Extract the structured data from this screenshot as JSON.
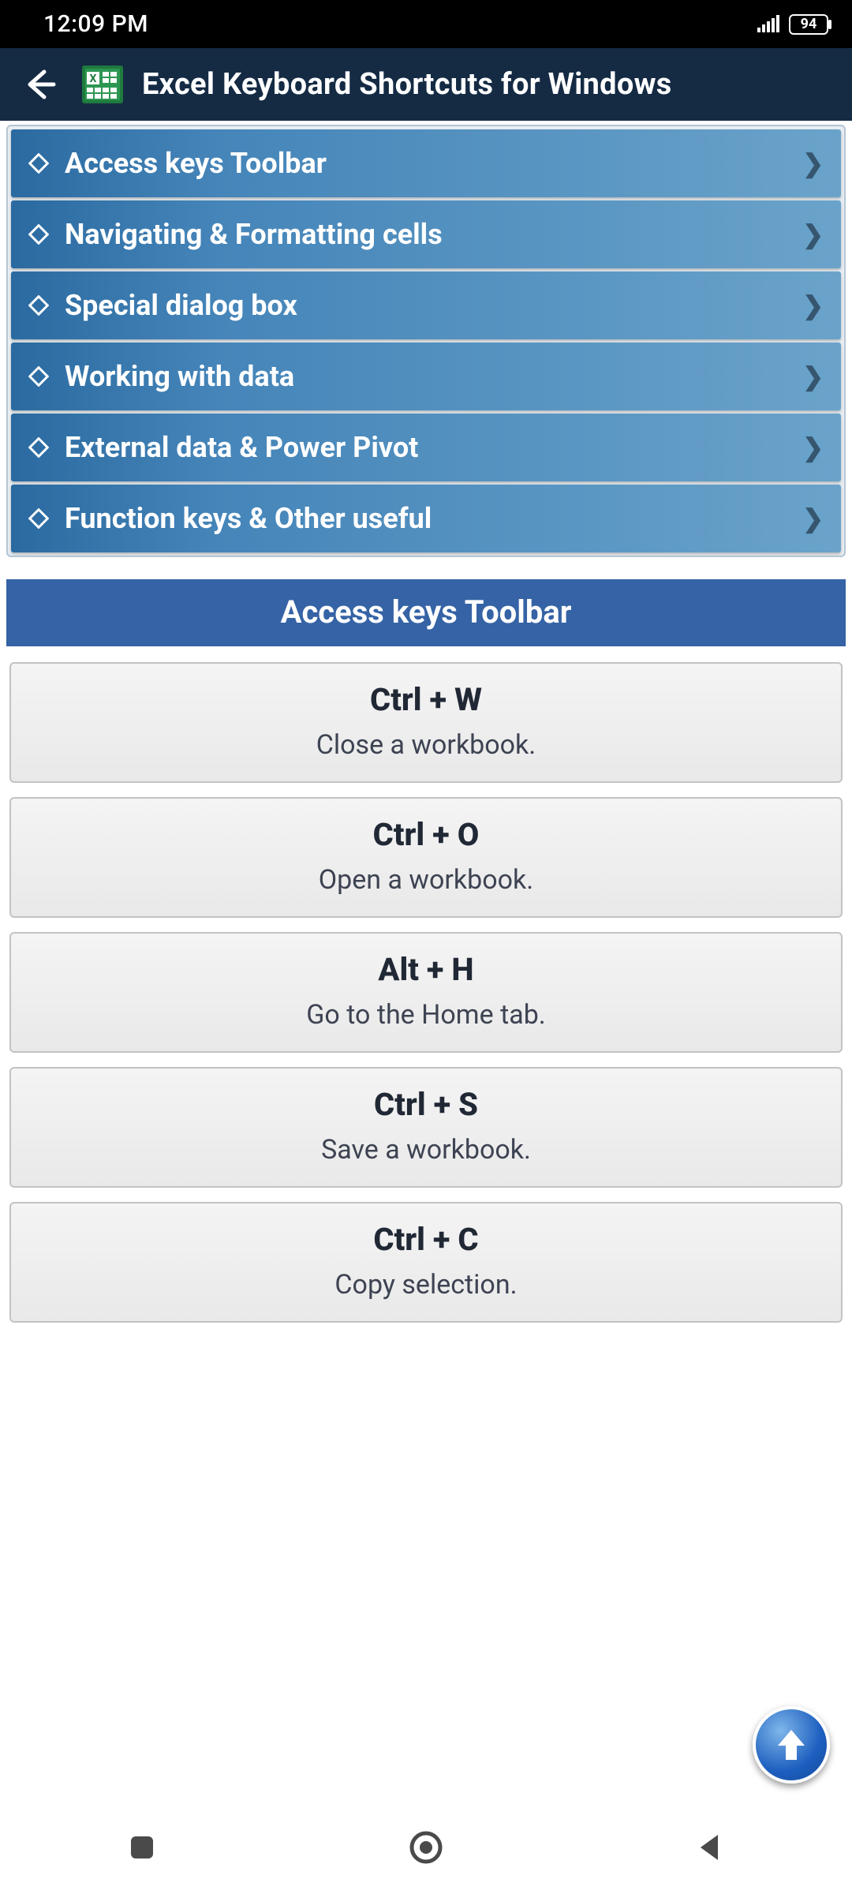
{
  "statusbar": {
    "time": "12:09 PM",
    "battery": "94"
  },
  "appbar": {
    "title": "Excel Keyboard Shortcuts for Windows"
  },
  "categories": [
    {
      "label": "Access keys Toolbar"
    },
    {
      "label": "Navigating & Formatting cells"
    },
    {
      "label": "Special dialog box"
    },
    {
      "label": "Working with data"
    },
    {
      "label": "External data & Power Pivot"
    },
    {
      "label": "Function keys & Other useful"
    }
  ],
  "section": {
    "title": "Access keys Toolbar"
  },
  "shortcuts": [
    {
      "key": "Ctrl + W",
      "desc": "Close a workbook."
    },
    {
      "key": "Ctrl + O",
      "desc": "Open a workbook."
    },
    {
      "key": "Alt + H",
      "desc": "Go to the Home tab."
    },
    {
      "key": "Ctrl + S",
      "desc": "Save a workbook."
    },
    {
      "key": "Ctrl + C",
      "desc": "Copy selection."
    }
  ]
}
